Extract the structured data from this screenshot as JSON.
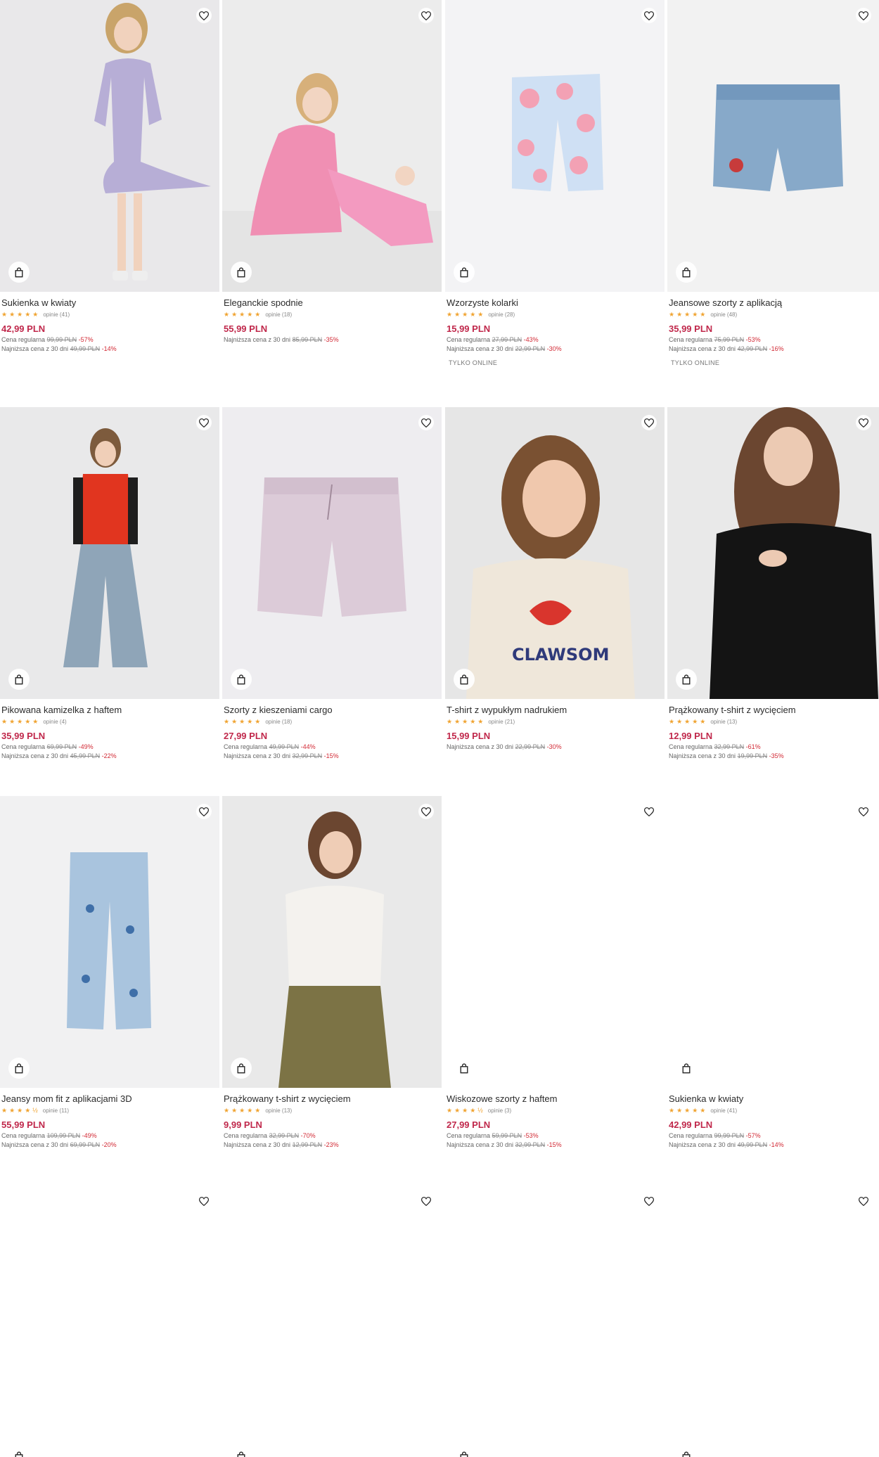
{
  "products": [
    {
      "name": "Sukienka w kwiaty",
      "reviews": "opinie (41)",
      "price": "42,99 PLN",
      "regular_label": "Cena regularna",
      "regular_old": "99,99 PLN",
      "regular_pct": "-57%",
      "lowest_label": "Najniższa cena z 30 dni",
      "lowest_old": "49,99 PLN",
      "lowest_pct": "-14%",
      "badge": "",
      "rating": 5
    },
    {
      "name": "Eleganckie spodnie",
      "reviews": "opinie (18)",
      "price": "55,99 PLN",
      "regular_label": "",
      "regular_old": "",
      "regular_pct": "",
      "lowest_label": "Najniższa cena z 30 dni",
      "lowest_old": "85,99 PLN",
      "lowest_pct": "-35%",
      "badge": "",
      "rating": 5
    },
    {
      "name": "Wzorzyste kolarki",
      "reviews": "opinie (28)",
      "price": "15,99 PLN",
      "regular_label": "Cena regularna",
      "regular_old": "27,99 PLN",
      "regular_pct": "-43%",
      "lowest_label": "Najniższa cena z 30 dni",
      "lowest_old": "22,99 PLN",
      "lowest_pct": "-30%",
      "badge": "TYLKO ONLINE",
      "rating": 5
    },
    {
      "name": "Jeansowe szorty z aplikacją",
      "reviews": "opinie (48)",
      "price": "35,99 PLN",
      "regular_label": "Cena regularna",
      "regular_old": "75,99 PLN",
      "regular_pct": "-53%",
      "lowest_label": "Najniższa cena z 30 dni",
      "lowest_old": "42,99 PLN",
      "lowest_pct": "-16%",
      "badge": "TYLKO ONLINE",
      "rating": 5
    },
    {
      "name": "Pikowana kamizelka z haftem",
      "reviews": "opinie (4)",
      "price": "35,99 PLN",
      "regular_label": "Cena regularna",
      "regular_old": "69,99 PLN",
      "regular_pct": "-49%",
      "lowest_label": "Najniższa cena z 30 dni",
      "lowest_old": "45,99 PLN",
      "lowest_pct": "-22%",
      "badge": "",
      "rating": 5
    },
    {
      "name": "Szorty z kieszeniami cargo",
      "reviews": "opinie (18)",
      "price": "27,99 PLN",
      "regular_label": "Cena regularna",
      "regular_old": "49,99 PLN",
      "regular_pct": "-44%",
      "lowest_label": "Najniższa cena z 30 dni",
      "lowest_old": "32,99 PLN",
      "lowest_pct": "-15%",
      "badge": "",
      "rating": 5
    },
    {
      "name": "T-shirt z wypukłym nadrukiem",
      "reviews": "opinie (21)",
      "price": "15,99 PLN",
      "regular_label": "",
      "regular_old": "",
      "regular_pct": "",
      "lowest_label": "Najniższa cena z 30 dni",
      "lowest_old": "22,99 PLN",
      "lowest_pct": "-30%",
      "badge": "",
      "rating": 5
    },
    {
      "name": "Prążkowany t-shirt z wycięciem",
      "reviews": "opinie (13)",
      "price": "12,99 PLN",
      "regular_label": "Cena regularna",
      "regular_old": "32,99 PLN",
      "regular_pct": "-61%",
      "lowest_label": "Najniższa cena z 30 dni",
      "lowest_old": "19,99 PLN",
      "lowest_pct": "-35%",
      "badge": "",
      "rating": 5
    },
    {
      "name": "Jeansy mom fit z aplikacjami 3D",
      "reviews": "opinie (11)",
      "price": "55,99 PLN",
      "regular_label": "Cena regularna",
      "regular_old": "109,99 PLN",
      "regular_pct": "-49%",
      "lowest_label": "Najniższa cena z 30 dni",
      "lowest_old": "69,99 PLN",
      "lowest_pct": "-20%",
      "badge": "",
      "rating": 4.5
    },
    {
      "name": "Prążkowany t-shirt z wycięciem",
      "reviews": "opinie (13)",
      "price": "9,99 PLN",
      "regular_label": "Cena regularna",
      "regular_old": "32,99 PLN",
      "regular_pct": "-70%",
      "lowest_label": "Najniższa cena z 30 dni",
      "lowest_old": "12,99 PLN",
      "lowest_pct": "-23%",
      "badge": "",
      "rating": 5
    },
    {
      "name": "Wiskozowe szorty z haftem",
      "reviews": "opinie (3)",
      "price": "27,99 PLN",
      "regular_label": "Cena regularna",
      "regular_old": "59,99 PLN",
      "regular_pct": "-53%",
      "lowest_label": "Najniższa cena z 30 dni",
      "lowest_old": "32,99 PLN",
      "lowest_pct": "-15%",
      "badge": "",
      "rating": 4.5
    },
    {
      "name": "Sukienka w kwiaty",
      "reviews": "opinie (41)",
      "price": "42,99 PLN",
      "regular_label": "Cena regularna",
      "regular_old": "99,99 PLN",
      "regular_pct": "-57%",
      "lowest_label": "Najniższa cena z 30 dni",
      "lowest_old": "49,99 PLN",
      "lowest_pct": "-14%",
      "badge": "",
      "rating": 5
    }
  ],
  "stars_full": "★★★★★",
  "stars_half": "★★★★½",
  "icons": {
    "favorite": "heart-icon",
    "cart": "shopping-bag-icon"
  },
  "colors": {
    "price": "#c0284b",
    "discount": "#d22a35",
    "stars": "#f0a432"
  }
}
